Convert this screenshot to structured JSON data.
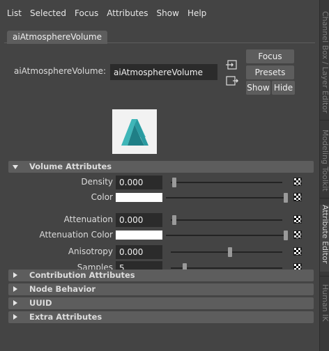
{
  "menu": [
    "List",
    "Selected",
    "Focus",
    "Attributes",
    "Show",
    "Help"
  ],
  "tab": {
    "label": "aiAtmosphereVolume"
  },
  "node": {
    "label": "aiAtmosphereVolume:",
    "value": "aiAtmosphereVolume"
  },
  "buttons": {
    "focus": "Focus",
    "presets": "Presets",
    "show": "Show",
    "hide": "Hide"
  },
  "icons": {
    "load_input": "input-connection-icon",
    "load_output": "output-connection-icon",
    "swatch": "arnold-logo-icon",
    "map": "checker-map-icon"
  },
  "sections": {
    "volume": "Volume Attributes",
    "contribution": "Contribution Attributes",
    "node_behavior": "Node Behavior",
    "uuid": "UUID",
    "extra": "Extra Attributes"
  },
  "attributes": [
    {
      "label": "Density",
      "value": "0.000",
      "kind": "number",
      "slider_level": 0.0
    },
    {
      "label": "Color",
      "kind": "color",
      "color": "#ffffff",
      "slider_level": 1.0
    },
    {
      "label": "Attenuation",
      "value": "0.000",
      "kind": "number",
      "slider_level": 0.0
    },
    {
      "label": "Attenuation Color",
      "kind": "color",
      "color": "#ffffff",
      "slider_level": 1.0
    },
    {
      "label": "Anisotropy",
      "value": "0.000",
      "kind": "number",
      "slider_level": 0.5
    },
    {
      "label": "Samples",
      "value": "5",
      "kind": "number",
      "slider_level": 0.03
    }
  ],
  "right_tabs": [
    "Channel Box / Layer Editor",
    "Modeling Toolkit",
    "Attribute Editor",
    "Human IK"
  ],
  "colors": {
    "panel": "#444444",
    "section": "#5d5d5d",
    "field": "#2b2b2b",
    "logo": "#2fa3a8"
  }
}
